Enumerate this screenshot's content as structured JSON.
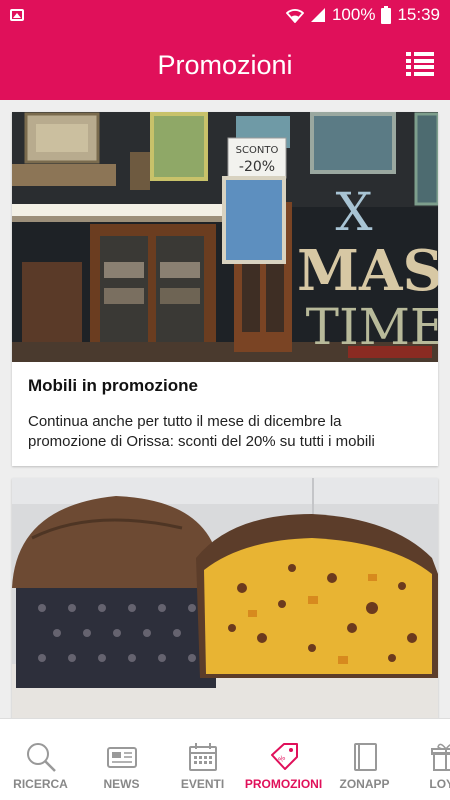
{
  "status_bar": {
    "battery": "100%",
    "time": "15:39"
  },
  "app_bar": {
    "title": "Promozioni"
  },
  "cards": [
    {
      "title": "Mobili in promozione",
      "description": "Continua anche per tutto il mese di dicembre la promozione di Orissa: sconti del 20% su tutti i mobili",
      "photo_text": {
        "sign_line1": "SCONTO",
        "sign_line2": "-20%",
        "letters_row1": "X",
        "letters_row2": "MAS",
        "letters_row3": "TIME"
      }
    },
    {
      "title": "",
      "description": ""
    }
  ],
  "bottom_nav": {
    "items": [
      {
        "label": "RICERCA",
        "icon": "search-icon"
      },
      {
        "label": "NEWS",
        "icon": "newspaper-icon"
      },
      {
        "label": "EVENTI",
        "icon": "calendar-icon"
      },
      {
        "label": "PROMOZIONI",
        "icon": "tag-icon"
      },
      {
        "label": "ZONAPP",
        "icon": "book-icon"
      },
      {
        "label": "LOYA",
        "icon": "gift-icon"
      }
    ],
    "active": "PROMOZIONI"
  },
  "colors": {
    "primary": "#e0105a",
    "nav_inactive": "#888888"
  }
}
